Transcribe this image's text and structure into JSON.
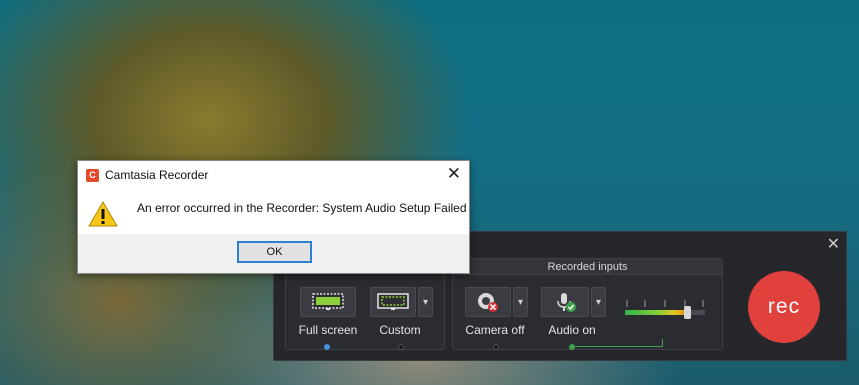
{
  "dialog": {
    "title": "Camtasia Recorder",
    "app_icon_letter": "C",
    "message": "An error occurred in the Recorder: System Audio Setup Failed",
    "ok_label": "OK",
    "close_icon": "close-icon",
    "warning_icon": "warning-icon"
  },
  "recorder": {
    "close_label": "✕",
    "screen": {
      "full_screen_label": "Full screen",
      "custom_label": "Custom"
    },
    "inputs": {
      "header": "Recorded inputs",
      "camera_label": "Camera off",
      "audio_label": "Audio on",
      "audio_level": 0.78
    },
    "rec_label": "rec",
    "colors": {
      "rec": "#e0413d",
      "selected_blue": "#4a90d9",
      "active_green": "#3fa34d"
    }
  }
}
